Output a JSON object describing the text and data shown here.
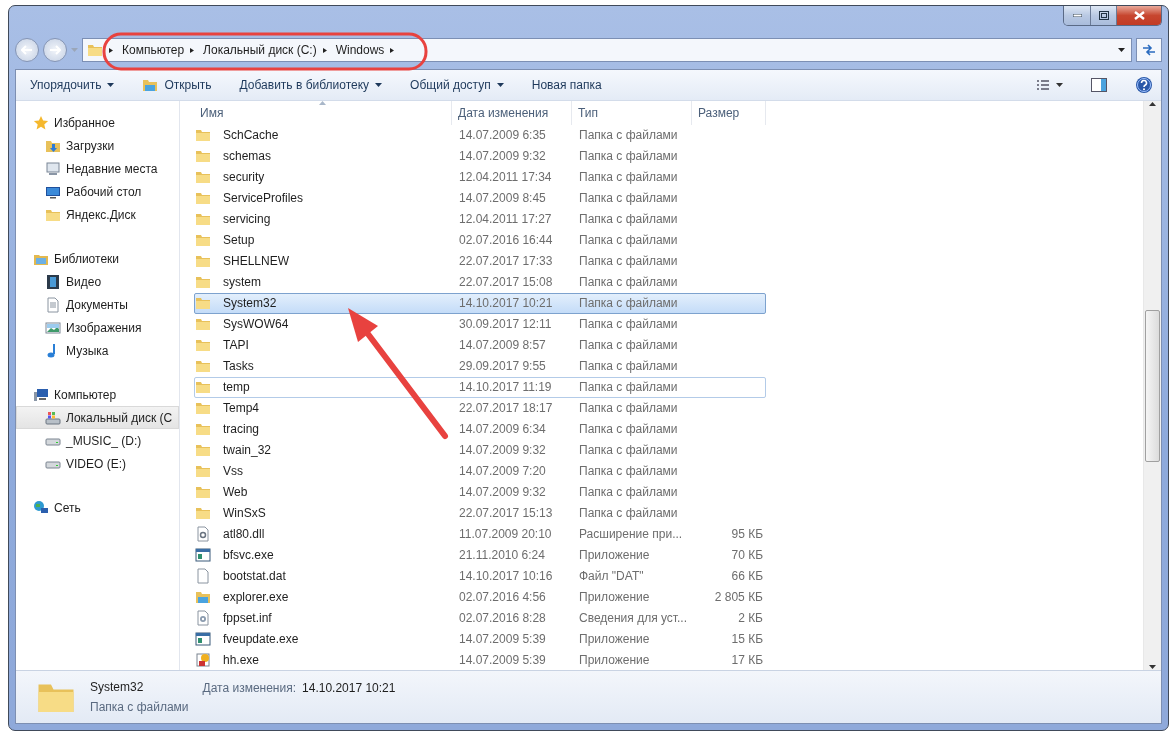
{
  "breadcrumb": [
    "Компьютер",
    "Локальный диск (C:)",
    "Windows"
  ],
  "toolbar": [
    {
      "label": "Упорядочить",
      "kind": "menu"
    },
    {
      "label": "Открыть",
      "kind": "open"
    },
    {
      "label": "Добавить в библиотеку",
      "kind": "menu"
    },
    {
      "label": "Общий доступ",
      "kind": "menu"
    },
    {
      "label": "Новая папка",
      "kind": "plain"
    }
  ],
  "sidebar": [
    {
      "label": "Избранное",
      "kind": "star",
      "children": [
        {
          "label": "Загрузки",
          "kind": "downloads",
          "selected": false
        },
        {
          "label": "Недавние места",
          "kind": "recent",
          "selected": false
        },
        {
          "label": "Рабочий стол",
          "kind": "desktop",
          "selected": false
        },
        {
          "label": "Яндекс.Диск",
          "kind": "folder",
          "selected": false
        }
      ]
    },
    {
      "label": "Библиотеки",
      "kind": "library",
      "children": [
        {
          "label": "Видео",
          "kind": "video",
          "selected": false
        },
        {
          "label": "Документы",
          "kind": "docs",
          "selected": false
        },
        {
          "label": "Изображения",
          "kind": "images",
          "selected": false
        },
        {
          "label": "Музыка",
          "kind": "music",
          "selected": false
        }
      ]
    },
    {
      "label": "Компьютер",
      "kind": "computer",
      "children": [
        {
          "label": "Локальный диск (C",
          "kind": "sysdrive",
          "selected": true
        },
        {
          "label": "_MUSIC_ (D:)",
          "kind": "drive",
          "selected": false
        },
        {
          "label": "VIDEO (E:)",
          "kind": "drive",
          "selected": false
        }
      ]
    },
    {
      "label": "Сеть",
      "kind": "network"
    }
  ],
  "table": {
    "columns": [
      "Имя",
      "Дата изменения",
      "Тип",
      "Размер"
    ],
    "rows": [
      {
        "kind": "folder",
        "name": "SchCache",
        "date": "14.07.2009 6:35",
        "type": "Папка с файлами",
        "selected": false,
        "focused": false
      },
      {
        "kind": "folder",
        "name": "schemas",
        "date": "14.07.2009 9:32",
        "type": "Папка с файлами",
        "selected": false,
        "focused": false
      },
      {
        "kind": "folder",
        "name": "security",
        "date": "12.04.2011 17:34",
        "type": "Папка с файлами",
        "selected": false,
        "focused": false
      },
      {
        "kind": "folder",
        "name": "ServiceProfiles",
        "date": "14.07.2009 8:45",
        "type": "Папка с файлами",
        "selected": false,
        "focused": false
      },
      {
        "kind": "folder",
        "name": "servicing",
        "date": "12.04.2011 17:27",
        "type": "Папка с файлами",
        "selected": false,
        "focused": false
      },
      {
        "kind": "folder",
        "name": "Setup",
        "date": "02.07.2016 16:44",
        "type": "Папка с файлами",
        "selected": false,
        "focused": false
      },
      {
        "kind": "folder",
        "name": "SHELLNEW",
        "date": "22.07.2017 17:33",
        "type": "Папка с файлами",
        "selected": false,
        "focused": false
      },
      {
        "kind": "folder",
        "name": "system",
        "date": "22.07.2017 15:08",
        "type": "Папка с файлами",
        "selected": false,
        "focused": false
      },
      {
        "kind": "folder",
        "name": "System32",
        "date": "14.10.2017 10:21",
        "type": "Папка с файлами",
        "selected": true,
        "focused": false
      },
      {
        "kind": "folder",
        "name": "SysWOW64",
        "date": "30.09.2017 12:11",
        "type": "Папка с файлами",
        "selected": false,
        "focused": false
      },
      {
        "kind": "folder",
        "name": "TAPI",
        "date": "14.07.2009 8:57",
        "type": "Папка с файлами",
        "selected": false,
        "focused": false
      },
      {
        "kind": "folder",
        "name": "Tasks",
        "date": "29.09.2017 9:55",
        "type": "Папка с файлами",
        "selected": false,
        "focused": false
      },
      {
        "kind": "folder",
        "name": "temp",
        "date": "14.10.2017 11:19",
        "type": "Папка с файлами",
        "selected": false,
        "focused": true
      },
      {
        "kind": "folder",
        "name": "Temp4",
        "date": "22.07.2017 18:17",
        "type": "Папка с файлами",
        "selected": false,
        "focused": false
      },
      {
        "kind": "folder",
        "name": "tracing",
        "date": "14.07.2009 6:34",
        "type": "Папка с файлами",
        "selected": false,
        "focused": false
      },
      {
        "kind": "folder",
        "name": "twain_32",
        "date": "14.07.2009 9:32",
        "type": "Папка с файлами",
        "selected": false,
        "focused": false
      },
      {
        "kind": "folder",
        "name": "Vss",
        "date": "14.07.2009 7:20",
        "type": "Папка с файлами",
        "selected": false,
        "focused": false
      },
      {
        "kind": "folder",
        "name": "Web",
        "date": "14.07.2009 9:32",
        "type": "Папка с файлами",
        "selected": false,
        "focused": false
      },
      {
        "kind": "folder",
        "name": "WinSxS",
        "date": "22.07.2017 15:13",
        "type": "Папка с файлами",
        "selected": false,
        "focused": false
      },
      {
        "kind": "dll",
        "name": "atl80.dll",
        "date": "11.07.2009 20:10",
        "type": "Расширение при...",
        "size": "95 КБ",
        "selected": false,
        "focused": false
      },
      {
        "kind": "exe",
        "name": "bfsvc.exe",
        "date": "21.11.2010 6:24",
        "type": "Приложение",
        "size": "70 КБ",
        "selected": false,
        "focused": false
      },
      {
        "kind": "file",
        "name": "bootstat.dat",
        "date": "14.10.2017 10:16",
        "type": "Файл \"DAT\"",
        "size": "66 КБ",
        "selected": false,
        "focused": false
      },
      {
        "kind": "explorer",
        "name": "explorer.exe",
        "date": "02.07.2016 4:56",
        "type": "Приложение",
        "size": "2 805 КБ",
        "selected": false,
        "focused": false
      },
      {
        "kind": "inf",
        "name": "fppset.inf",
        "date": "02.07.2016 8:28",
        "type": "Сведения для уст...",
        "size": "2 КБ",
        "selected": false,
        "focused": false
      },
      {
        "kind": "exe",
        "name": "fveupdate.exe",
        "date": "14.07.2009 5:39",
        "type": "Приложение",
        "size": "15 КБ",
        "selected": false,
        "focused": false
      },
      {
        "kind": "help",
        "name": "hh.exe",
        "date": "14.07.2009 5:39",
        "type": "Приложение",
        "size": "17 КБ",
        "selected": false,
        "focused": false
      }
    ]
  },
  "details": {
    "name": "System32",
    "type": "Папка с файлами",
    "date_label": "Дата изменения:",
    "date": "14.10.2017 10:21"
  }
}
